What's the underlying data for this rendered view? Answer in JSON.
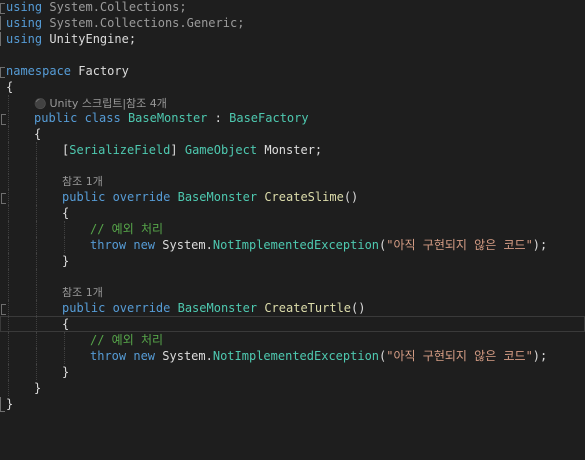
{
  "colors": {
    "background": "#1e1e1e",
    "keyword": "#569cd6",
    "type": "#4ec9b0",
    "method": "#dcdcaa",
    "string": "#d69d85",
    "comment": "#57a64a",
    "plain": "#dcdcdc",
    "codelens": "#999999"
  },
  "code": {
    "using_kw": "using",
    "ns1": "System.Collections;",
    "ns2": "System.Collections.Generic;",
    "ns3": "UnityEngine;",
    "namespace_kw": "namespace",
    "namespace_name": "Factory",
    "brace_open": "{",
    "brace_close": "}",
    "unity_lens_icon": "unity-icon",
    "unity_lens_text": "Unity 스크립트|참조 4개",
    "public_class_kw": "public class",
    "class_name": "BaseMonster",
    "colon": ":",
    "base_class": "BaseFactory",
    "bracket_open": "[",
    "attribute": "SerializeField",
    "bracket_close": "]",
    "field_type": "GameObject",
    "field_name": "Monster;",
    "ref_lens_1": "참조 1개",
    "public_override_kw": "public override",
    "return_type": "BaseMonster",
    "method1": "CreateSlime",
    "parens": "()",
    "comment": "// 예외 처리",
    "throw_kw": "throw",
    "new_kw": "new",
    "system_ns": "System.",
    "exception_type": "NotImplementedException",
    "paren_open": "(",
    "message": "\"아직 구현되지 않은 코드\"",
    "paren_close_semi": ");",
    "ref_lens_2": "참조 1개",
    "method2": "CreateTurtle"
  }
}
